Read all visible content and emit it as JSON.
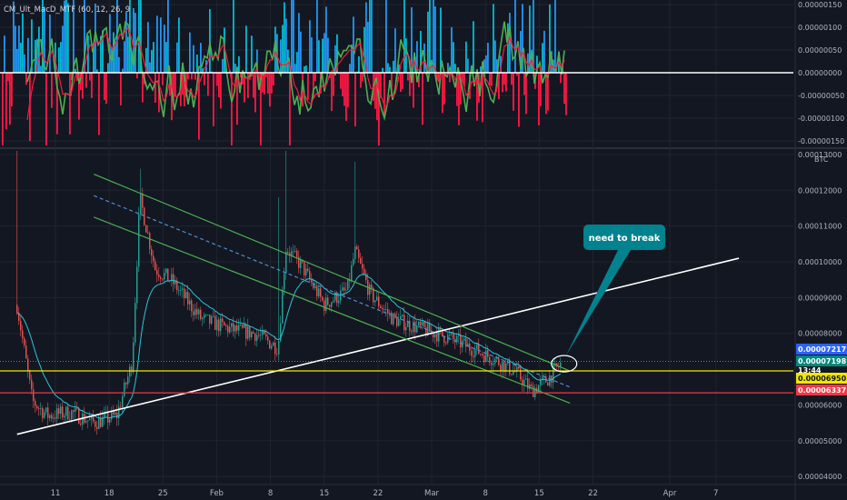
{
  "colors": {
    "background": "#131722",
    "grid": "#1f2430",
    "candle_up": "#26a69a",
    "candle_down": "#ef5350",
    "channel_green": "#4caf50",
    "trendline_white": "#ffffff",
    "dashed_blue": "#4f8cc9",
    "ma_teal": "#26c6da",
    "support_yellow": "#f2e600",
    "support_red": "#f23645",
    "macd_blue": "#2196f3",
    "macd_aqua": "#00bcd4",
    "macd_red": "#ff1744",
    "macd_green": "#4caf50",
    "callout_fill": "#00838f"
  },
  "indicator": {
    "title": "CM_Ult_MacD_MTF (60, 12, 26, 9",
    "axis_labels": [
      "0.00000150",
      "0.00000100",
      "0.00000050",
      "0.00000000",
      "-0.00000050",
      "-0.00000100",
      "-0.00000150"
    ]
  },
  "main": {
    "currency_label": "BTC",
    "price_axis_labels": [
      "0.00013000",
      "0.00012000",
      "0.00011000",
      "0.00010000",
      "0.00009000",
      "0.00008000",
      "0.00006000",
      "0.00005000",
      "0.00004000"
    ],
    "badges": {
      "current_price": "0.00007217",
      "last_price": "0.00007198",
      "countdown": "13:44",
      "yellow_level": "0.00006950",
      "red_level": "0.00006337"
    },
    "annotation": "need to break"
  },
  "time_axis": {
    "labels": [
      "11",
      "18",
      "25",
      "Feb",
      "8",
      "15",
      "22",
      "Mar",
      "8",
      "15",
      "22",
      "Apr",
      "7"
    ]
  },
  "chart_data": {
    "type": "candlestick",
    "currency": "BTC",
    "ylim": [
      3.8e-05,
      0.000131
    ],
    "x": [
      "Jan 6",
      "Jan 8",
      "Jan 10",
      "Jan 13",
      "Jan 16",
      "Jan 19",
      "Jan 21",
      "Jan 22",
      "Jan 24",
      "Jan 26",
      "Jan 30",
      "Feb 3",
      "Feb 6",
      "Feb 9",
      "Feb 10",
      "Feb 12",
      "Feb 15",
      "Feb 18",
      "Feb 19",
      "Feb 21",
      "Feb 24",
      "Feb 28",
      "Mar 3",
      "Mar 6",
      "Mar 9",
      "Mar 12",
      "Mar 14",
      "Mar 16",
      "Mar 18"
    ],
    "close": [
      8.8e-05,
      6.1e-05,
      5.7e-05,
      5.8e-05,
      5.5e-05,
      5.7e-05,
      7.2e-05,
      0.000118,
      9.8e-05,
      9.5e-05,
      8.4e-05,
      8.1e-05,
      8e-05,
      7.6e-05,
      0.000104,
      9.9e-05,
      8.8e-05,
      9.2e-05,
      0.000103,
      9.1e-05,
      8.4e-05,
      8.1e-05,
      7.9e-05,
      7.6e-05,
      7.3e-05,
      6.9e-05,
      6.4e-05,
      6.7e-05,
      7.2e-05
    ],
    "lines": [
      {
        "name": "white trendline",
        "from": [
          "Jan 6",
          5.18e-05
        ],
        "to": [
          "Apr 10",
          0.000101
        ]
      },
      {
        "name": "channel upper",
        "from": [
          "Jan 16",
          0.0001245
        ],
        "to": [
          "Mar 19",
          6.95e-05
        ]
      },
      {
        "name": "channel lower",
        "from": [
          "Jan 16",
          0.0001125
        ],
        "to": [
          "Mar 19",
          6.05e-05
        ]
      },
      {
        "name": "channel middle (dashed)",
        "from": [
          "Jan 16",
          0.0001185
        ],
        "to": [
          "Mar 19",
          6.5e-05
        ]
      },
      {
        "name": "yellow horizontal",
        "value": 6.95e-05
      },
      {
        "name": "red horizontal",
        "value": 6.337e-05
      }
    ],
    "annotations": [
      {
        "text": "need to break",
        "near": [
          "Mar 18",
          7.22e-05
        ]
      }
    ],
    "indicator": {
      "name": "CM_Ult_MacD_MTF (60, 12, 26, 9",
      "ylim": [
        -1.6e-06,
        1.6e-06
      ]
    }
  }
}
